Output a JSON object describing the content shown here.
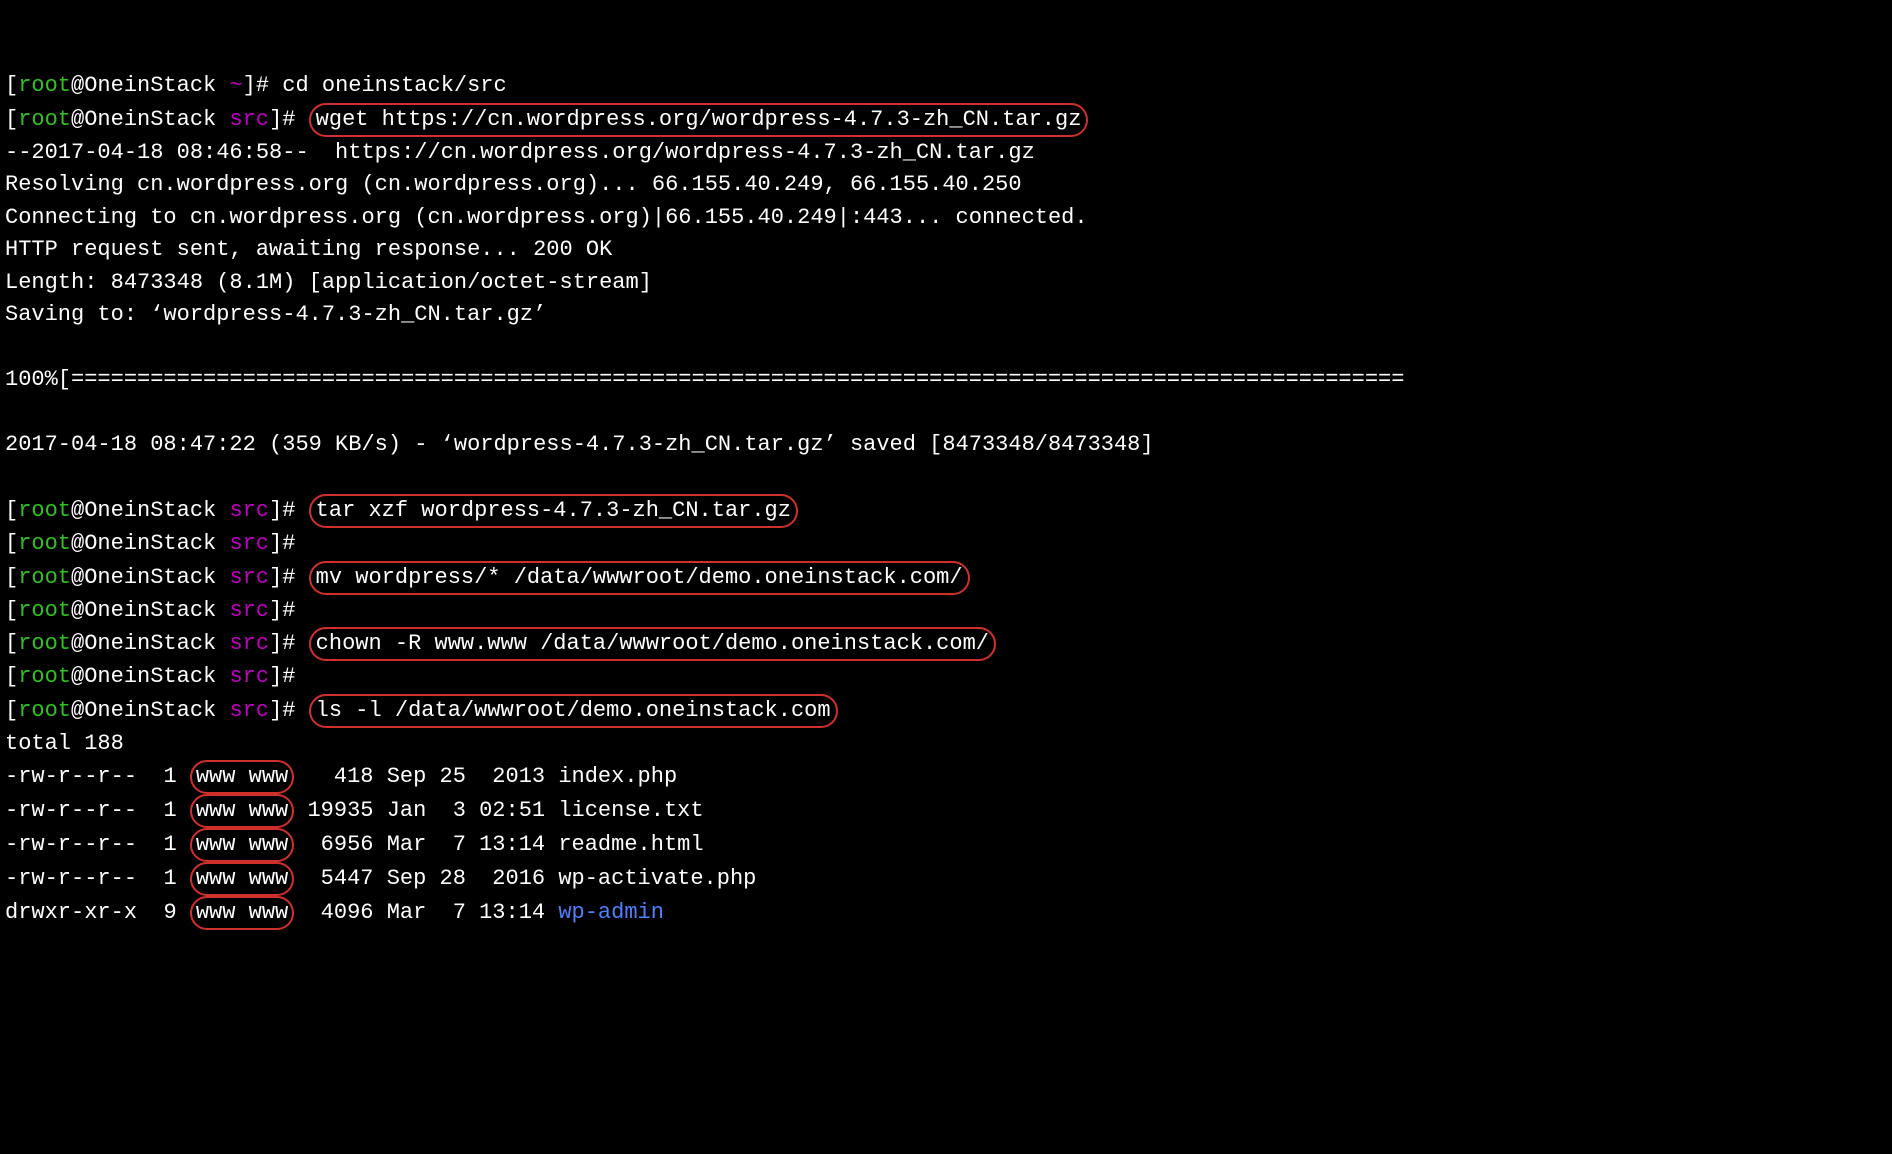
{
  "prompt": {
    "user": "root",
    "host": "OneinStack",
    "home_dir": "~",
    "src_dir": "src"
  },
  "cmd_cd": "cd oneinstack/src",
  "cmd_wget": "wget https://cn.wordpress.org/wordpress-4.7.3-zh_CN.tar.gz",
  "out_wget_time": "--2017-04-18 08:46:58--  https://cn.wordpress.org/wordpress-4.7.3-zh_CN.tar.gz",
  "out_wget_resolve": "Resolving cn.wordpress.org (cn.wordpress.org)... 66.155.40.249, 66.155.40.250",
  "out_wget_connect": "Connecting to cn.wordpress.org (cn.wordpress.org)|66.155.40.249|:443... connected.",
  "out_wget_http": "HTTP request sent, awaiting response... 200 OK",
  "out_wget_length": "Length: 8473348 (8.1M) [application/octet-stream]",
  "out_wget_saving": "Saving to: ‘wordpress-4.7.3-zh_CN.tar.gz’",
  "out_wget_progress": "100%[=====================================================================================================",
  "out_wget_done": "2017-04-18 08:47:22 (359 KB/s) - ‘wordpress-4.7.3-zh_CN.tar.gz’ saved [8473348/8473348]",
  "cmd_tar": "tar xzf wordpress-4.7.3-zh_CN.tar.gz",
  "cmd_mv": "mv wordpress/* /data/wwwroot/demo.oneinstack.com/",
  "cmd_chown": "chown -R www.www /data/wwwroot/demo.oneinstack.com/",
  "cmd_ls": "ls -l /data/wwwroot/demo.oneinstack.com",
  "ls_total": "total 188",
  "ls_rows": [
    {
      "perm": "-rw-r--r--",
      "links": "1",
      "owner": "www www",
      "size": "  418",
      "date": "Sep 25  2013",
      "name": "index.php",
      "dir": false
    },
    {
      "perm": "-rw-r--r--",
      "links": "1",
      "owner": "www www",
      "size": "19935",
      "date": "Jan  3 02:51",
      "name": "license.txt",
      "dir": false
    },
    {
      "perm": "-rw-r--r--",
      "links": "1",
      "owner": "www www",
      "size": " 6956",
      "date": "Mar  7 13:14",
      "name": "readme.html",
      "dir": false
    },
    {
      "perm": "-rw-r--r--",
      "links": "1",
      "owner": "www www",
      "size": " 5447",
      "date": "Sep 28  2016",
      "name": "wp-activate.php",
      "dir": false
    },
    {
      "perm": "drwxr-xr-x",
      "links": "9",
      "owner": "www www",
      "size": " 4096",
      "date": "Mar  7 13:14",
      "name": "wp-admin",
      "dir": true
    }
  ]
}
